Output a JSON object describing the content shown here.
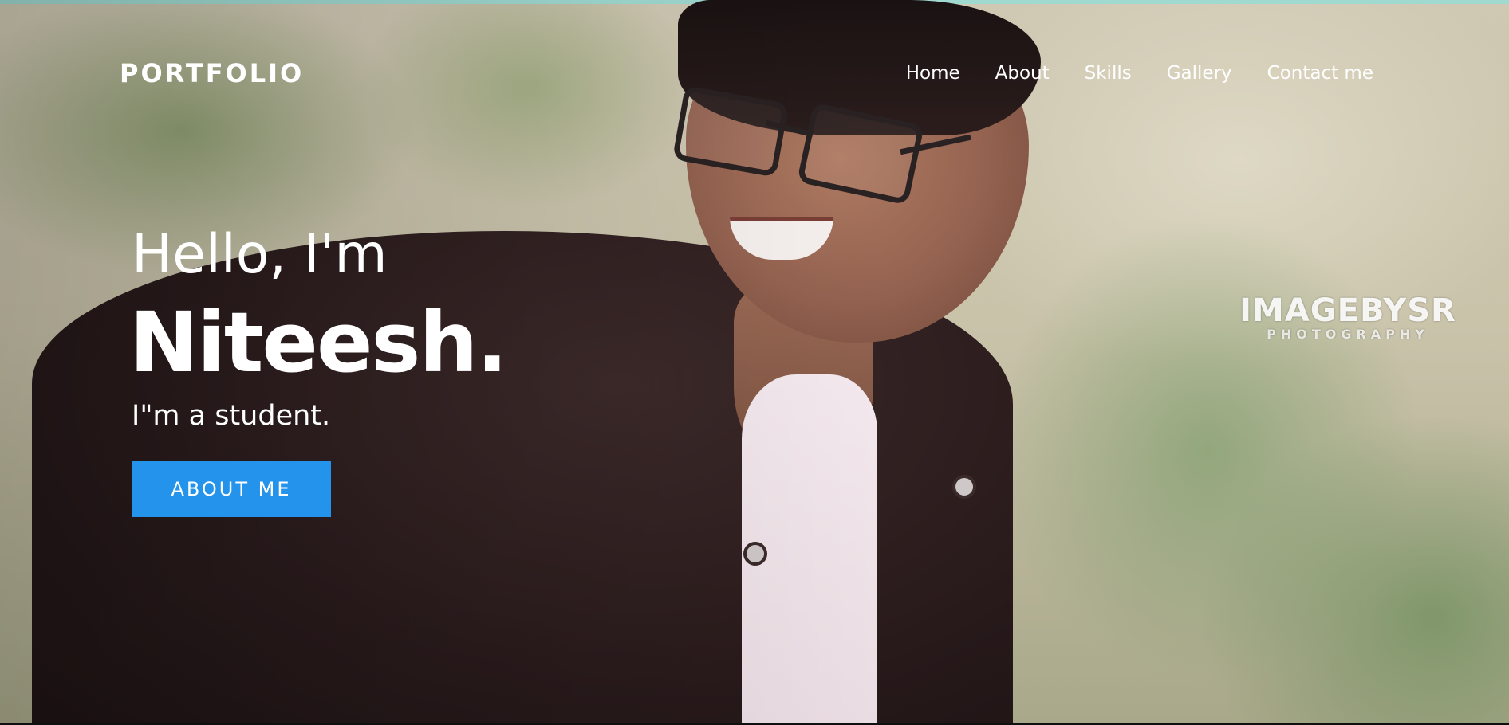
{
  "header": {
    "brand": "PORTFOLIO",
    "nav": [
      {
        "label": "Home"
      },
      {
        "label": "About"
      },
      {
        "label": "Skills"
      },
      {
        "label": "Gallery"
      },
      {
        "label": "Contact me"
      }
    ]
  },
  "hero": {
    "greeting": "Hello, I'm",
    "name": "Niteesh.",
    "tagline": "I\"m a student.",
    "cta_label": "ABOUT ME",
    "watermark": {
      "main": "IMAGEBYSR",
      "sub": "PHOTOGRAPHY"
    }
  },
  "colors": {
    "accent": "#2493ec",
    "top_strip": "#9fd9d0",
    "text": "#ffffff"
  }
}
